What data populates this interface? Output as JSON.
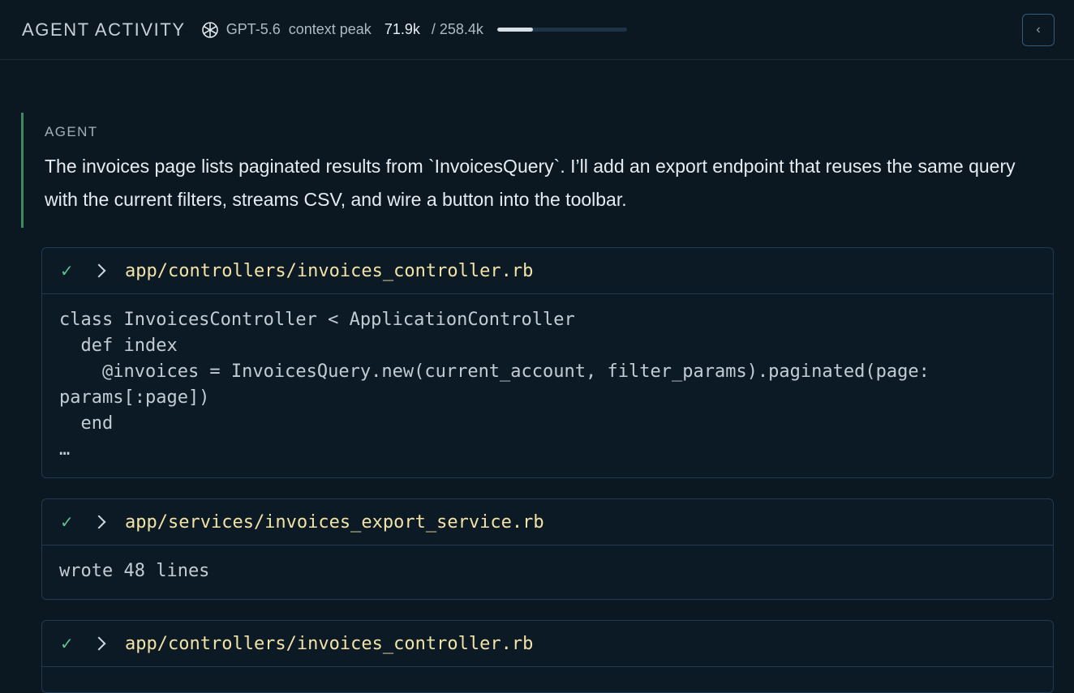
{
  "header": {
    "title": "AGENT ACTIVITY",
    "model_icon": "openai-logo-icon",
    "model_name": "GPT-5.6",
    "context_label": "context peak",
    "context_peak": "71.9k",
    "context_total": "/ 258.4k",
    "context_fraction": 0.278,
    "collapse_glyph": "‹",
    "collapse_icon": "chevron-left-icon"
  },
  "agent_message": {
    "role_label": "AGENT",
    "text": "The invoices page lists paginated results from `InvoicesQuery`. I’ll add an export endpoint that reuses the same query with the current filters, streams CSV, and wire a button into the toolbar."
  },
  "tool_calls": [
    {
      "status_glyph": "✓",
      "status_icon": "check-icon",
      "expand_icon": "chevron-right-icon",
      "path": "app/controllers/invoices_controller.rb",
      "output": "class InvoicesController < ApplicationController\n  def index\n    @invoices = InvoicesQuery.new(current_account, filter_params).paginated(page:\nparams[:page])\n  end\n…"
    },
    {
      "status_glyph": "✓",
      "status_icon": "check-icon",
      "expand_icon": "chevron-right-icon",
      "path": "app/services/invoices_export_service.rb",
      "output": "wrote 48 lines"
    },
    {
      "status_glyph": "✓",
      "status_icon": "check-icon",
      "expand_icon": "chevron-right-icon",
      "path": "app/controllers/invoices_controller.rb",
      "output": ""
    }
  ],
  "colors": {
    "background": "#0c1821",
    "accent_green": "#3f8a5d",
    "path_yellow": "#f2e3a6",
    "check_green": "#5fc48a"
  }
}
